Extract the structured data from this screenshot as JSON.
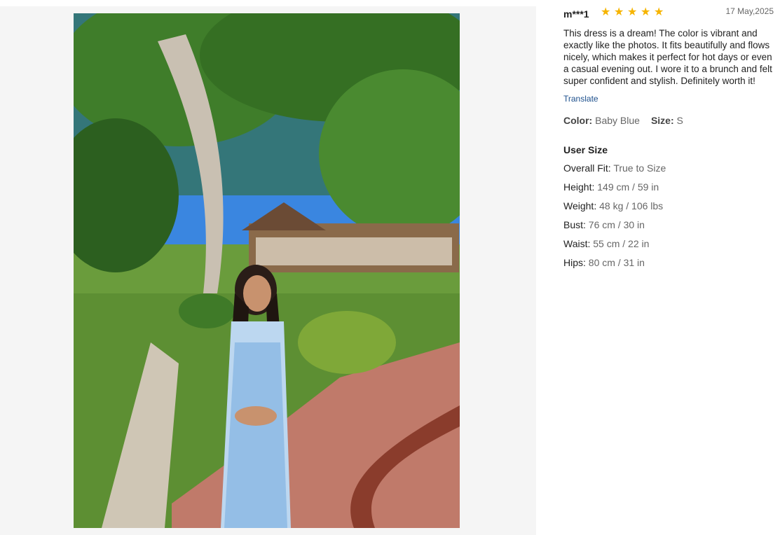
{
  "review": {
    "reviewer": "m***1",
    "rating": 5,
    "date": "17 May,2025",
    "text": "This dress is a dream! The color is vibrant and exactly like the photos. It fits beautifully and flows nicely, which makes it perfect for hot days or even a casual evening out. I wore it to a brunch and felt super confident and stylish. Definitely worth it!",
    "translate_label": "Translate",
    "color_label": "Color:",
    "color_value": "Baby Blue",
    "size_label": "Size:",
    "size_value": "S"
  },
  "user_size": {
    "title": "User Size",
    "rows": [
      {
        "label": "Overall Fit:",
        "value": "True to Size"
      },
      {
        "label": "Height:",
        "value": "149 cm / 59 in"
      },
      {
        "label": "Weight:",
        "value": "48 kg / 106 lbs"
      },
      {
        "label": "Bust:",
        "value": "76 cm / 30 in"
      },
      {
        "label": "Waist:",
        "value": "55 cm / 22 in"
      },
      {
        "label": "Hips:",
        "value": "80 cm / 31 in"
      }
    ]
  },
  "colors": {
    "star": "#f6b400",
    "link": "#1c4f8c",
    "panel_bg": "#f5f5f5"
  },
  "icons": {
    "star": "star-icon"
  }
}
